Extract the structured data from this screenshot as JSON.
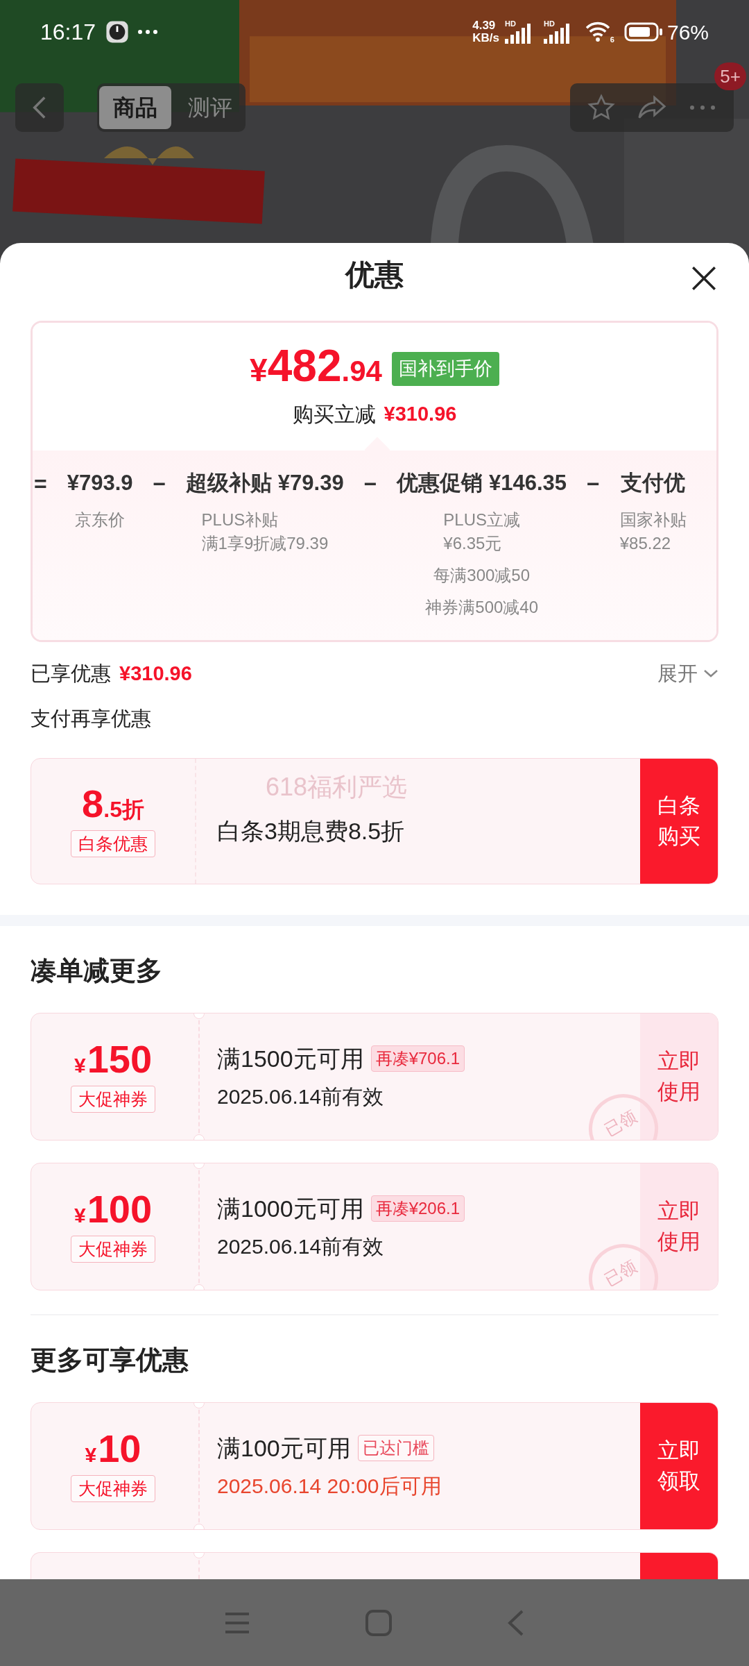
{
  "status_bar": {
    "time": "16:17",
    "speed_value": "4.39",
    "speed_unit": "KB/s",
    "signal_labels": [
      "HD",
      "HD"
    ],
    "wifi_label": "6",
    "battery": "76%"
  },
  "nav": {
    "tabs": [
      {
        "label": "商品",
        "selected": true
      },
      {
        "label": "测评",
        "selected": false
      }
    ],
    "badge": "5+"
  },
  "sheet": {
    "title": "优惠"
  },
  "price_card": {
    "currency": "¥",
    "integer": "482",
    "decimal": ".94",
    "badge": "国补到手价",
    "saving_label": "购买立减",
    "saving_amount": "¥310.96",
    "breakdown": [
      {
        "operator": "=",
        "amount": "¥793.9",
        "notes": [
          [
            "京东价"
          ]
        ]
      },
      {
        "operator": "−",
        "label": "超级补贴",
        "amount": "¥79.39",
        "notes": [
          [
            "PLUS补贴",
            "满1享9折减79.39"
          ]
        ]
      },
      {
        "operator": "−",
        "label": "优惠促销",
        "amount": "¥146.35",
        "notes": [
          [
            "PLUS立减",
            "¥6.35元"
          ],
          [
            "每满300减50"
          ],
          [
            "神券满500减40"
          ]
        ]
      },
      {
        "operator": "−",
        "label": "支付优",
        "notes": [
          [
            "国家补贴",
            "¥85.22"
          ]
        ]
      }
    ]
  },
  "enjoyed": {
    "label": "已享优惠",
    "amount": "¥310.96",
    "expand": "展开"
  },
  "pay_section": {
    "title": "支付再享优惠",
    "card": {
      "value": "8",
      "unit": ".5折",
      "tag": "白条优惠",
      "decor": "618福利严选",
      "title": "白条3期息费8.5折",
      "action": "白条购买"
    }
  },
  "sections": [
    {
      "title": "凑单减更多",
      "coupons": [
        {
          "kind": "coupon",
          "currency": "¥",
          "amount": "150",
          "tag": "大促神券",
          "title": "满1500元可用",
          "chip": "再凑¥706.1",
          "chip_filled": true,
          "validity": "2025.06.14前有效",
          "validity_highlight": false,
          "claimed": true,
          "stamp": "已领",
          "action": "立即使用"
        },
        {
          "kind": "coupon",
          "currency": "¥",
          "amount": "100",
          "tag": "大促神券",
          "title": "满1000元可用",
          "chip": "再凑¥206.1",
          "chip_filled": true,
          "validity": "2025.06.14前有效",
          "validity_highlight": false,
          "claimed": true,
          "stamp": "已领",
          "action": "立即使用"
        }
      ]
    },
    {
      "title": "更多可享优惠",
      "coupons": [
        {
          "kind": "coupon",
          "currency": "¥",
          "amount": "10",
          "tag": "大促神券",
          "title": "满100元可用",
          "chip": "已达门槛",
          "chip_filled": false,
          "validity": "2025.06.14 20:00后可用",
          "validity_highlight": true,
          "claimed": false,
          "action": "立即领取"
        },
        {
          "kind": "cut_off"
        }
      ]
    }
  ]
}
